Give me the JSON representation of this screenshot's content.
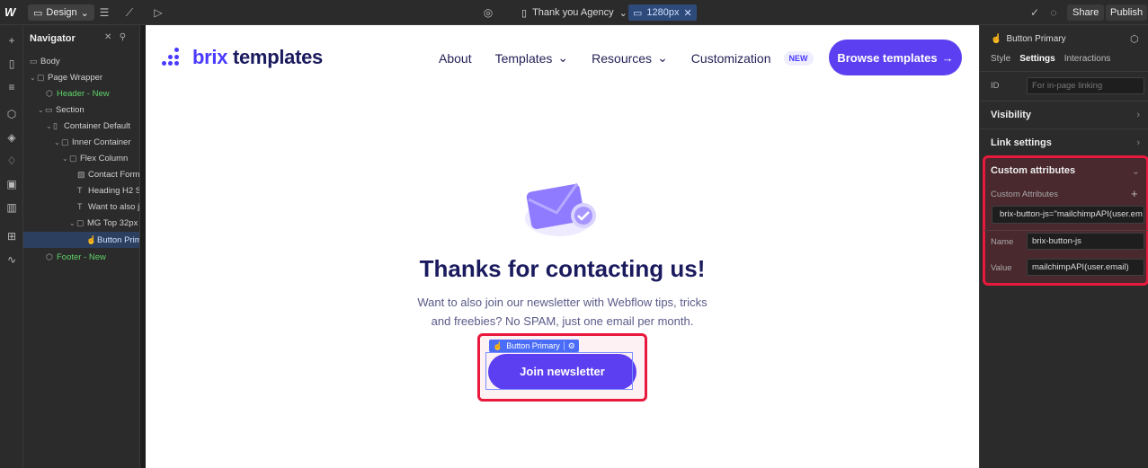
{
  "topbar": {
    "mode": "Design",
    "page": "Thank you Agency",
    "breakpoint": "1280px",
    "share": "Share",
    "publish": "Publish"
  },
  "navigator": {
    "title": "Navigator",
    "items": [
      {
        "label": "Body"
      },
      {
        "label": "Page Wrapper"
      },
      {
        "label": "Header - New"
      },
      {
        "label": "Section"
      },
      {
        "label": "Container Default"
      },
      {
        "label": "Inner Container"
      },
      {
        "label": "Flex Column"
      },
      {
        "label": "Contact Form"
      },
      {
        "label": "Heading H2 S"
      },
      {
        "label": "Want to also j"
      },
      {
        "label": "MG Top 32px"
      },
      {
        "label": "Button Prim"
      },
      {
        "label": "Footer - New"
      }
    ]
  },
  "site": {
    "brand_bold": "brix",
    "brand_rest": "templates",
    "nav": {
      "about": "About",
      "templates": "Templates",
      "resources": "Resources",
      "customization": "Customization",
      "new_badge": "NEW"
    },
    "browse": "Browse templates",
    "title": "Thanks for contacting us!",
    "subtitle_line1": "Want to also join our newsletter with Webflow tips, tricks",
    "subtitle_line2": "and freebies? No SPAM, just one email per month.",
    "element_tag": "Button Primary",
    "join": "Join newsletter",
    "accent": "#5b3ff0"
  },
  "settings": {
    "element": "Button Primary",
    "tabs": {
      "style": "Style",
      "settings": "Settings",
      "interactions": "Interactions"
    },
    "id_label": "ID",
    "id_placeholder": "For in-page linking",
    "visibility": "Visibility",
    "link_settings": "Link settings",
    "custom_attributes": "Custom attributes",
    "custom_attributes_sub": "Custom Attributes",
    "attribute_summary": "brix-button-js=\"mailchimpAPI(user.em",
    "name_label": "Name",
    "name_value": "brix-button-js",
    "value_label": "Value",
    "value_value": "mailchimpAPI(user.email)",
    "highlight_color": "#e8193c"
  }
}
